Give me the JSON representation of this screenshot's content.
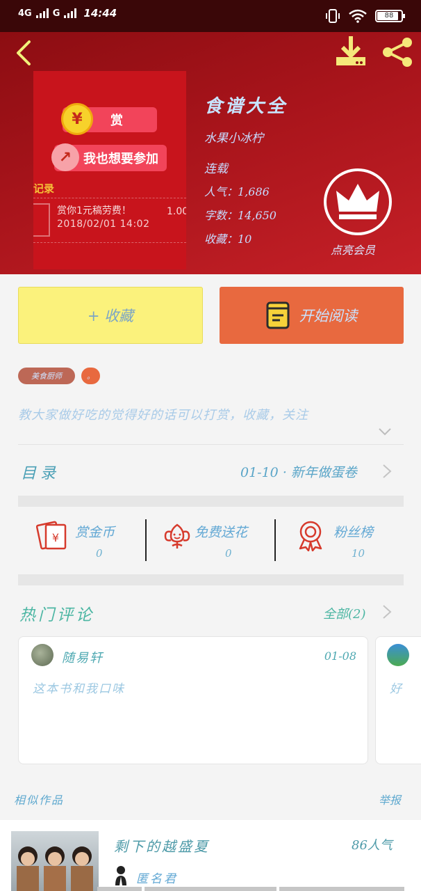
{
  "status_bar": {
    "net1": "4G",
    "net2": "G",
    "time": "14:44",
    "battery": "88"
  },
  "header": {
    "cover": {
      "reward_label": "赏",
      "join_label": "我也想要参加",
      "record_title": "记录",
      "record_text": "赏你1元稿劳费！",
      "record_date": "2018/02/01 14:02",
      "record_amount": "1.00"
    },
    "title": "食谱大全",
    "author": "水果小冰柠",
    "serial_status": "连载",
    "popularity": "人气：1,686",
    "word_count": "字数：14,650",
    "favorites": "收藏：10",
    "vip_label": "点亮会员"
  },
  "actions": {
    "favorite": "+ 收藏",
    "read": "开始阅读"
  },
  "tags": [
    "美食厨师",
    "。"
  ],
  "description": "教大家做好吃的觉得好的话可以打赏，收藏，关注",
  "toc": {
    "label": "目录",
    "info": "01-10 · 新年做蛋卷"
  },
  "stats": [
    {
      "name": "赏金币",
      "value": "0",
      "icon": "reward-envelope-icon"
    },
    {
      "name": "免费送花",
      "value": "0",
      "icon": "flower-icon"
    },
    {
      "name": "粉丝榜",
      "value": "10",
      "icon": "medal-icon"
    }
  ],
  "comments": {
    "title": "热门评论",
    "all_link": "全部(2)",
    "items": [
      {
        "user": "随易轩",
        "date": "01-08",
        "text": "这本书和我口味"
      },
      {
        "user": "",
        "date": "",
        "text": "好"
      }
    ]
  },
  "similar": {
    "title": "相似作品",
    "report": "举报"
  },
  "work": {
    "title": "剩下的越盛夏",
    "popularity": "86人气",
    "author": "匿名君"
  },
  "colors": {
    "header_red": "#a8141b",
    "favorite_yellow": "#fbf27c",
    "read_orange": "#e8693f"
  }
}
